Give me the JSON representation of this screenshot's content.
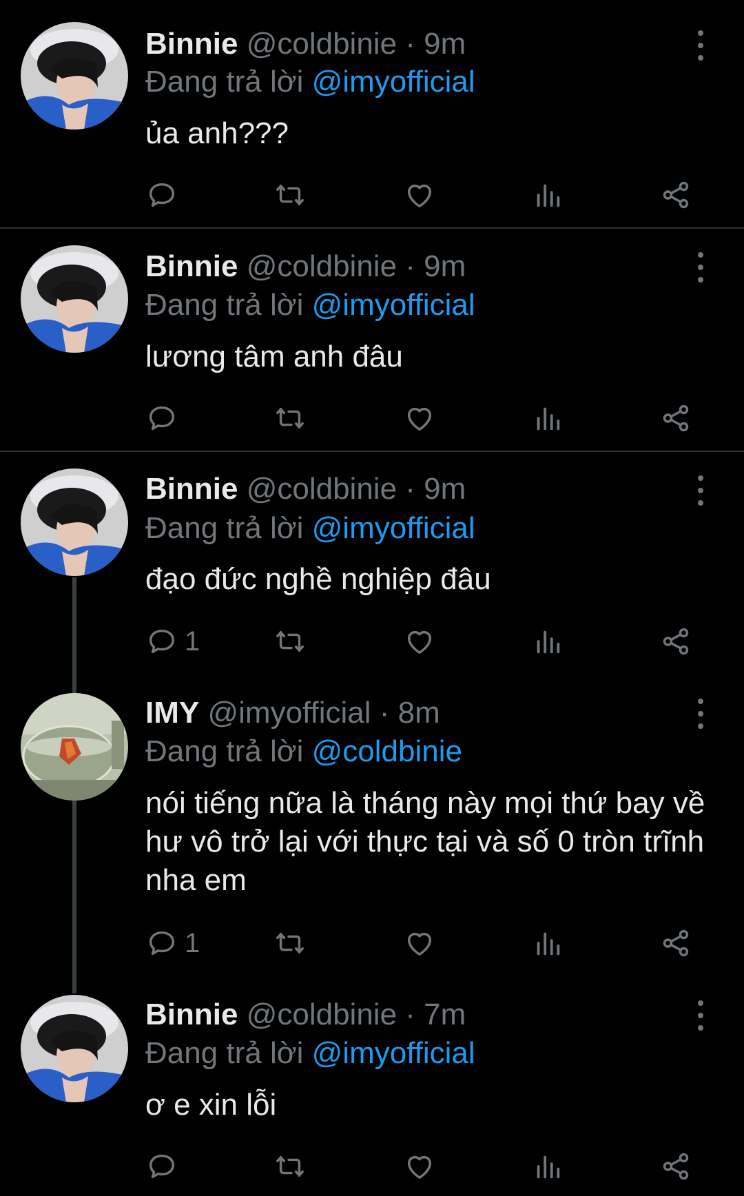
{
  "tweets": [
    {
      "name": "Binnie",
      "handle": "@coldbinie",
      "time": "9m",
      "reply_prefix": "Đang trả lời",
      "reply_to": "@imyofficial",
      "text": "ủa anh???",
      "reply_count": ""
    },
    {
      "name": "Binnie",
      "handle": "@coldbinie",
      "time": "9m",
      "reply_prefix": "Đang trả lời",
      "reply_to": "@imyofficial",
      "text": "lương tâm anh đâu",
      "reply_count": ""
    },
    {
      "name": "Binnie",
      "handle": "@coldbinie",
      "time": "9m",
      "reply_prefix": "Đang trả lời",
      "reply_to": "@imyofficial",
      "text": "đạo đức nghề nghiệp đâu",
      "reply_count": "1"
    },
    {
      "name": "IMY",
      "handle": "@imyofficial",
      "time": "8m",
      "reply_prefix": "Đang trả lời",
      "reply_to": "@coldbinie",
      "text": "nói tiếng nữa là tháng này mọi thứ bay về hư vô trở lại với thực tại và số 0 tròn trĩnh nha em",
      "reply_count": "1"
    },
    {
      "name": "Binnie",
      "handle": "@coldbinie",
      "time": "7m",
      "reply_prefix": "Đang trả lời",
      "reply_to": "@imyofficial",
      "text": "ơ e xin lỗi",
      "reply_count": ""
    }
  ],
  "separator": "·",
  "icons": [
    "reply-icon",
    "retweet-icon",
    "like-icon",
    "analytics-icon",
    "share-icon",
    "more-icon"
  ],
  "colors": {
    "background": "#000000",
    "primary_text": "#e7e9ea",
    "secondary_text": "#71767b",
    "mention": "#1d9bf0",
    "divider": "#2f3336"
  }
}
